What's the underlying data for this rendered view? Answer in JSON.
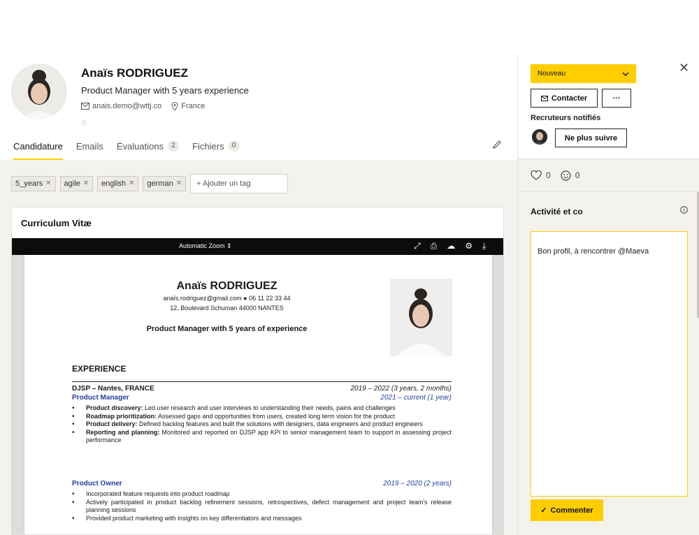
{
  "candidate": {
    "name": "Anaïs RODRIGUEZ",
    "headline": "Product Manager with 5 years experience",
    "email": "anais.demo@wttj.co",
    "location": "France"
  },
  "tabs": [
    {
      "label": "Candidature"
    },
    {
      "label": "Emails"
    },
    {
      "label": "Évaluations",
      "count": "2"
    },
    {
      "label": "Fichiers",
      "count": "0"
    }
  ],
  "tags": [
    "5_years",
    "agile",
    "english",
    "german"
  ],
  "tag_input": {
    "placeholder": "+ Ajouter un tag"
  },
  "cv_card": {
    "title": "Curriculum Vitæ",
    "viewer": {
      "zoom": "Automatic Zoom"
    }
  },
  "cv": {
    "name": "Anaïs RODRIGUEZ",
    "contact": "anaïs.rodriguez@gmail.com ● 06 11 22 33 44",
    "address": "12, Boulevard Schuman 44000 NANTES",
    "headline": "Product Manager with 5 years of experience",
    "section": "EXPERIENCE",
    "company": "DJSP – Nantes, FRANCE",
    "company_dates": "2019 – 2022 (3 years, 2 months)",
    "role1": "Product Manager",
    "role1_dates": "2021 – current (1 year)",
    "role1_bullets": [
      {
        "b": "Product discovery:",
        "t": " Led user research and user interviews to understanding their needs, pains and challenges"
      },
      {
        "b": "Roadmap prioritization:",
        "t": " Assessed gaps and opportunities from users, created long term vision for the product"
      },
      {
        "b": "Product delivery:",
        "t": " Defined backlog features and built the solutions with designers, data engineers and product engineers"
      },
      {
        "b": "Reporting and planning:",
        "t": " Monitored and reported on DJSP app KPI to senior management team to support in assessing project performance"
      }
    ],
    "role2": "Product Owner",
    "role2_dates": "2019 – 2020 (2 years)",
    "role2_bullets": [
      "Incorporated feature requests into product roadmap",
      "Actively participated in product backlog refinement sessions, retrospectives, defect management and project team's release planning sessions",
      "Provided product marketing with insights on key differentiators and messages"
    ]
  },
  "sidebar": {
    "status": "Nouveau",
    "contact_button": "Contacter",
    "more_button": "···",
    "notified_label": "Recruteurs notifiés",
    "unfollow_button": "Ne plus suivre",
    "likes": "0",
    "smiles": "0",
    "activity_title": "Activité et co",
    "comment_text": "Bon profil, à rencontrer @Maeva",
    "comment_button": "Commenter"
  },
  "colors": {
    "accent": "#ffcd00",
    "link_blue": "#1f3f9e",
    "panel_bg": "#f4f2ee"
  }
}
